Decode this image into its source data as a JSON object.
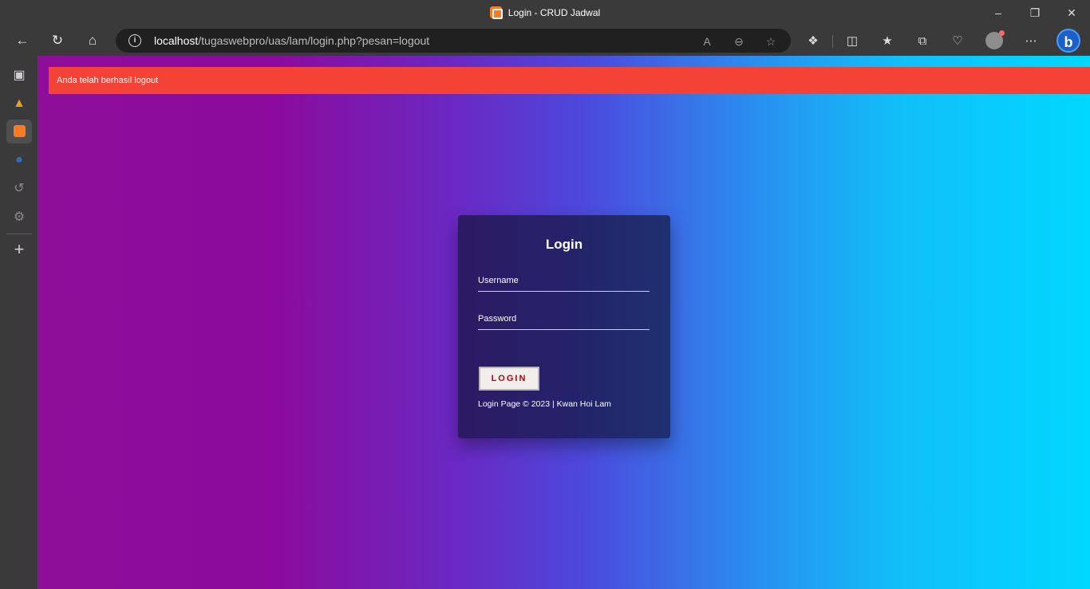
{
  "window": {
    "title": "Login - CRUD Jadwal",
    "controls": [
      "minimize-icon",
      "restore-icon",
      "close-icon"
    ]
  },
  "browser": {
    "url_host": "localhost",
    "url_path": "/tugaswebpro/uas/lam/login.php?pesan=logout"
  },
  "sidebar_icons": [
    "tabs-icon",
    "app-icon",
    "xampp-icon",
    "edge-icon",
    "history-icon",
    "settings-icon",
    "add-icon"
  ],
  "page": {
    "alert": "Anda telah berhasil logout",
    "login": {
      "title": "Login",
      "username_placeholder": "Username",
      "password_placeholder": "Password",
      "button_label": "LOGIN",
      "footer": "Login Page © 2023 | Kwan Hoi Lam"
    }
  },
  "colors": {
    "alert_bg": "#f44336",
    "gradient_start": "#8e0e9a",
    "gradient_end": "#00d8ff",
    "button_text": "#b3001b"
  }
}
